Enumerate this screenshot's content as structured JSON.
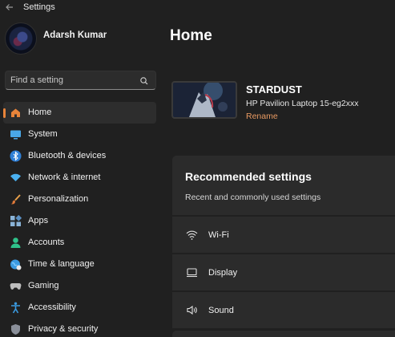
{
  "window": {
    "title": "Settings"
  },
  "profile": {
    "name": "Adarsh Kumar"
  },
  "search": {
    "placeholder": "Find a setting"
  },
  "sidebar": {
    "items": [
      {
        "label": "Home",
        "icon": "home-icon",
        "active": true
      },
      {
        "label": "System",
        "icon": "system-icon"
      },
      {
        "label": "Bluetooth & devices",
        "icon": "bluetooth-icon"
      },
      {
        "label": "Network & internet",
        "icon": "network-icon"
      },
      {
        "label": "Personalization",
        "icon": "brush-icon"
      },
      {
        "label": "Apps",
        "icon": "apps-icon"
      },
      {
        "label": "Accounts",
        "icon": "accounts-icon"
      },
      {
        "label": "Time & language",
        "icon": "globe-icon"
      },
      {
        "label": "Gaming",
        "icon": "gamepad-icon"
      },
      {
        "label": "Accessibility",
        "icon": "accessibility-icon"
      },
      {
        "label": "Privacy & security",
        "icon": "shield-icon"
      }
    ]
  },
  "main": {
    "title": "Home",
    "device": {
      "name": "STARDUST",
      "model": "HP Pavilion Laptop 15-eg2xxx",
      "rename_label": "Rename"
    },
    "recommended": {
      "title": "Recommended settings",
      "subtitle": "Recent and commonly used settings",
      "items": [
        {
          "label": "Wi-Fi",
          "icon": "wifi-icon"
        },
        {
          "label": "Display",
          "icon": "display-icon"
        },
        {
          "label": "Sound",
          "icon": "sound-icon"
        }
      ]
    }
  },
  "colors": {
    "accent": "#e8843a",
    "link": "#e89a62",
    "background": "#202020",
    "card": "#2b2b2b"
  }
}
